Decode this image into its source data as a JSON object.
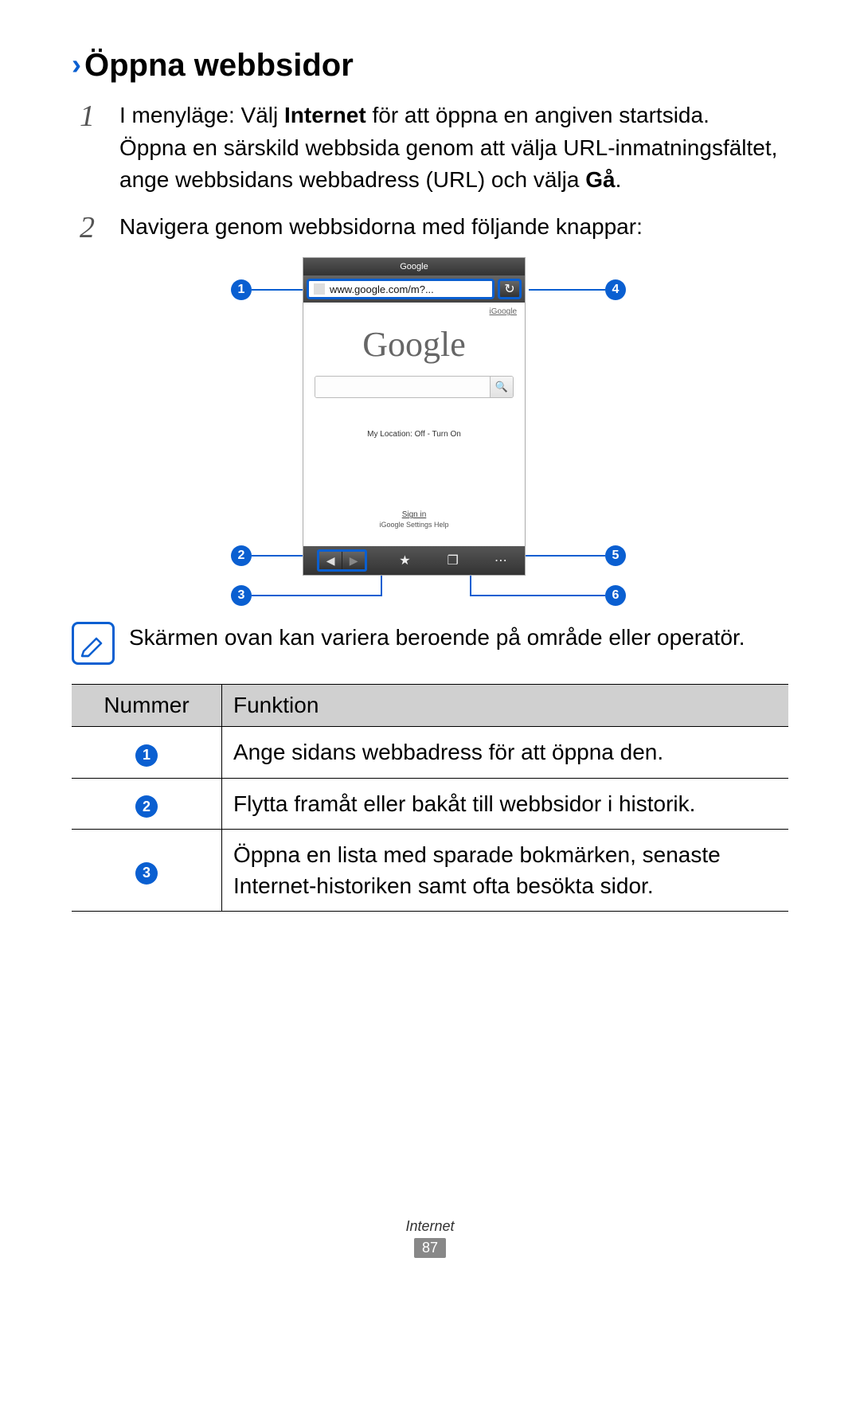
{
  "heading": "Öppna webbsidor",
  "steps": [
    {
      "num": "1",
      "prefix": "I menyläge: Välj ",
      "bold1": "Internet",
      "mid": " för att öppna en angiven startsida.",
      "line2a": "Öppna en särskild webbsida genom att välja URL-inmatningsfältet, ange webbsidans webbadress (URL) och välja ",
      "bold2": "Gå",
      "line2b": "."
    },
    {
      "num": "2",
      "text": "Navigera genom webbsidorna med följande knappar:"
    }
  ],
  "callouts": {
    "c1": "1",
    "c2": "2",
    "c3": "3",
    "c4": "4",
    "c5": "5",
    "c6": "6"
  },
  "phone": {
    "title": "Google",
    "url": "www.google.com/m?...",
    "igoogle": "iGoogle",
    "logo": "Google",
    "location": "My Location: Off - Turn On",
    "signin": "Sign in",
    "footerline": "iGoogle   Settings   Help"
  },
  "note": "Skärmen ovan kan variera beroende på område eller operatör.",
  "table": {
    "headers": {
      "col1": "Nummer",
      "col2": "Funktion"
    },
    "rows": [
      {
        "n": "1",
        "text": "Ange sidans webbadress för att öppna den."
      },
      {
        "n": "2",
        "text": "Flytta framåt eller bakåt till webbsidor i historik."
      },
      {
        "n": "3",
        "text": "Öppna en lista med sparade bokmärken, senaste Internet-historiken samt ofta besökta sidor."
      }
    ]
  },
  "footer": {
    "section": "Internet",
    "page": "87"
  }
}
